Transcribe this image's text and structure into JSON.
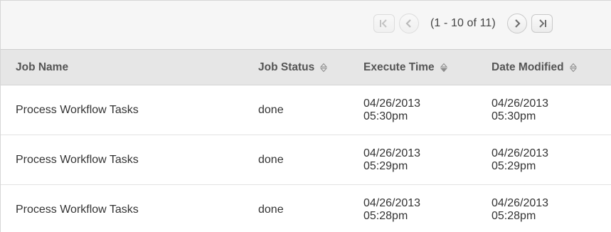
{
  "pager": {
    "range_text": "(1 - 10 of 11)",
    "first_icon": "first-page-icon",
    "prev_icon": "previous-page-icon",
    "next_icon": "next-page-icon",
    "last_icon": "last-page-icon"
  },
  "table": {
    "columns": [
      {
        "label": "Job Name",
        "sortable": false
      },
      {
        "label": "Job Status",
        "sortable": true
      },
      {
        "label": "Execute Time",
        "sortable": true
      },
      {
        "label": "Date Modified",
        "sortable": true
      }
    ],
    "rows": [
      {
        "job_name": "Process Workflow Tasks",
        "status": "done",
        "execute_date": "04/26/2013",
        "execute_time": "05:30pm",
        "modified_date": "04/26/2013",
        "modified_time": "05:30pm"
      },
      {
        "job_name": "Process Workflow Tasks",
        "status": "done",
        "execute_date": "04/26/2013",
        "execute_time": "05:29pm",
        "modified_date": "04/26/2013",
        "modified_time": "05:29pm"
      },
      {
        "job_name": "Process Workflow Tasks",
        "status": "done",
        "execute_date": "04/26/2013",
        "execute_time": "05:28pm",
        "modified_date": "04/26/2013",
        "modified_time": "05:28pm"
      }
    ]
  },
  "colors": {
    "header_bg": "#e6e6e6",
    "pager_bg": "#f6f6f6",
    "text": "#333333"
  }
}
